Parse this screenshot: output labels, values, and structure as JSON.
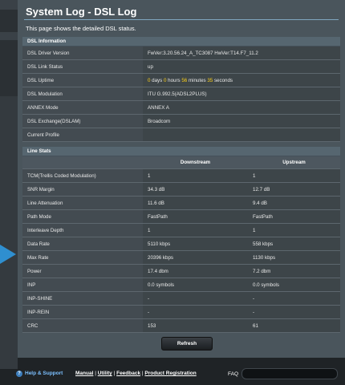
{
  "title": "System Log - DSL Log",
  "description": "This page shows the detailed DSL status.",
  "dsl_info": {
    "header": "DSL Information",
    "rows": [
      {
        "label": "DSL Driver Version",
        "value": "FwVer:3.20.56.24_A_TC3087 HwVer:T14.F7_11.2"
      },
      {
        "label": "DSL Link Status",
        "value": "up"
      },
      {
        "label": "DSL Uptime",
        "uptime": {
          "d": "0",
          "d_unit": " days ",
          "h": "0",
          "h_unit": " hours ",
          "m": "56",
          "m_unit": " minutes ",
          "s": "35",
          "s_unit": " seconds"
        }
      },
      {
        "label": "DSL Modulation",
        "value": "ITU G.992.5(ADSL2PLUS)"
      },
      {
        "label": "ANNEX Mode",
        "value": "ANNEX A"
      },
      {
        "label": "DSL Exchange(DSLAM)",
        "value": "Broadcom"
      },
      {
        "label": "Current Profile",
        "value": ""
      }
    ]
  },
  "line_stats": {
    "header": "Line Stats",
    "columns": [
      "Downstream",
      "Upstream"
    ],
    "rows": [
      {
        "label": "TCM(Trellis Coded Modulation)",
        "down": "1",
        "up": "1"
      },
      {
        "label": "SNR Margin",
        "down": "34.3 dB",
        "up": "12.7 dB"
      },
      {
        "label": "Line Attenuation",
        "down": "11.6 dB",
        "up": "9.4 dB"
      },
      {
        "label": "Path Mode",
        "down": "FastPath",
        "up": "FastPath"
      },
      {
        "label": "Interleave Depth",
        "down": "1",
        "up": "1"
      },
      {
        "label": "Data Rate",
        "down": "5110 kbps",
        "up": "558 kbps"
      },
      {
        "label": "Max Rate",
        "down": "20396 kbps",
        "up": "1130 kbps"
      },
      {
        "label": "Power",
        "down": "17.4 dbm",
        "up": "7.2 dbm"
      },
      {
        "label": "INP",
        "down": "0.0 symbols",
        "up": "0.0 symbols"
      },
      {
        "label": "INP-SHINE",
        "down": "-",
        "up": "-"
      },
      {
        "label": "INP-REIN",
        "down": "-",
        "up": "-"
      },
      {
        "label": "CRC",
        "down": "153",
        "up": "61"
      }
    ]
  },
  "refresh_label": "Refresh",
  "footer": {
    "help_icon": "question-icon",
    "help": "Help & Support",
    "links": [
      "Manual",
      "Utility",
      "Feedback",
      "Product Registration"
    ],
    "separator": " | ",
    "faq": "FAQ"
  },
  "colors": {
    "highlight": "#ffd21a",
    "panel": "#4a555c",
    "section_header": "#566670"
  }
}
